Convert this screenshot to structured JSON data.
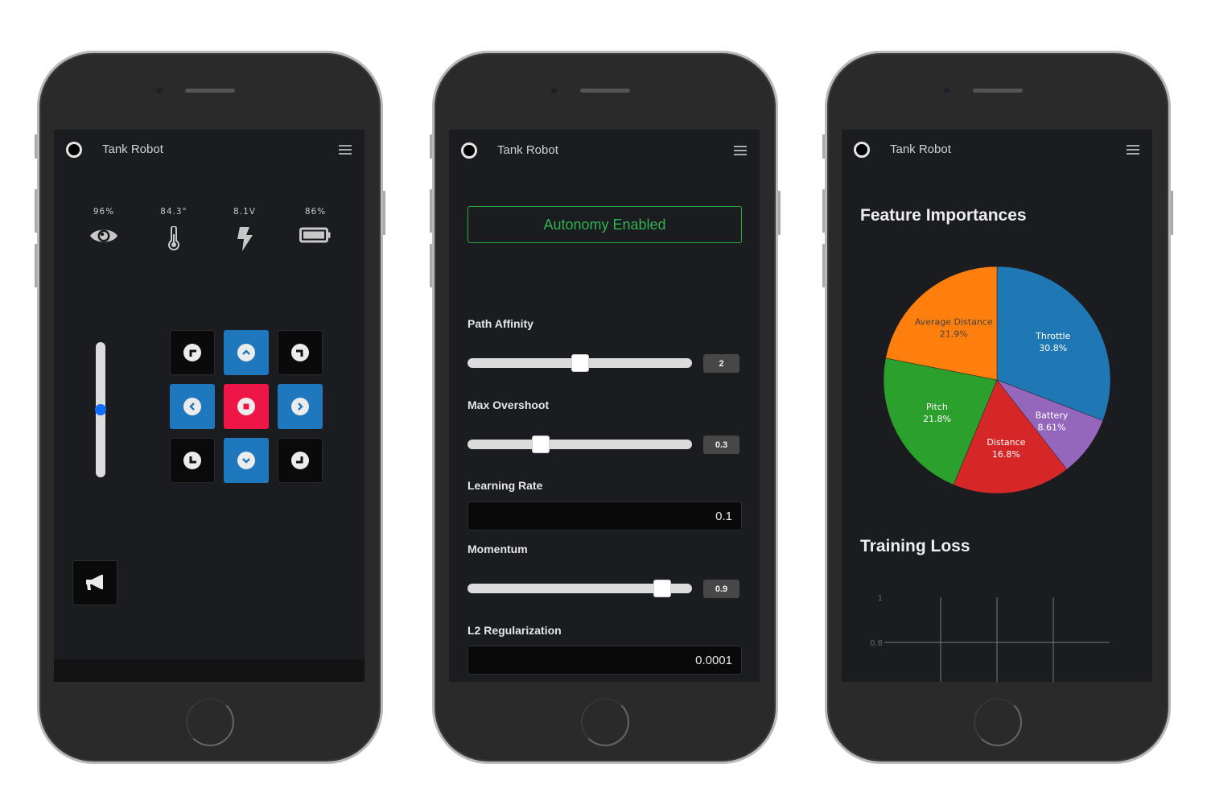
{
  "app": {
    "title": "Tank Robot"
  },
  "screen1": {
    "stats": [
      {
        "icon": "eye-icon",
        "value": "96%"
      },
      {
        "icon": "thermometer-icon",
        "value": "84.3°"
      },
      {
        "icon": "lightning-icon",
        "value": "8.1V"
      },
      {
        "icon": "battery-icon",
        "value": "86%"
      }
    ],
    "throttle": {
      "value_fraction": 0.5
    },
    "dpad": [
      {
        "name": "forward-left",
        "icon": "corner-up-left-icon",
        "style": "dark"
      },
      {
        "name": "forward",
        "icon": "chevron-up-icon",
        "style": "blue"
      },
      {
        "name": "forward-right",
        "icon": "corner-up-right-icon",
        "style": "dark"
      },
      {
        "name": "left",
        "icon": "chevron-left-icon",
        "style": "blue"
      },
      {
        "name": "stop",
        "icon": "stop-icon",
        "style": "red"
      },
      {
        "name": "right",
        "icon": "chevron-right-icon",
        "style": "blue"
      },
      {
        "name": "backward-left",
        "icon": "corner-down-left-icon",
        "style": "dark"
      },
      {
        "name": "backward",
        "icon": "chevron-down-icon",
        "style": "blue"
      },
      {
        "name": "backward-right",
        "icon": "corner-down-right-icon",
        "style": "dark"
      }
    ],
    "horn": {
      "icon": "megaphone-icon"
    }
  },
  "screen2": {
    "autonomy_label": "Autonomy Enabled",
    "path_affinity": {
      "label": "Path Affinity",
      "value": "2",
      "fraction": 0.5
    },
    "max_overshoot": {
      "label": "Max Overshoot",
      "value": "0.3",
      "fraction": 0.31
    },
    "learning_rate": {
      "label": "Learning Rate",
      "value": "0.1"
    },
    "momentum": {
      "label": "Momentum",
      "value": "0.9",
      "fraction": 0.9
    },
    "l2_regularization": {
      "label": "L2 Regularization",
      "value": "0.0001"
    }
  },
  "screen3": {
    "feature_title": "Feature Importances",
    "loss_title": "Training Loss"
  },
  "colors": {
    "accent_blue": "#1f78bd",
    "stop_red": "#ee1547",
    "autonomy_green": "#2fb150",
    "slider_blue": "#0d6efd"
  },
  "chart_data": [
    {
      "type": "pie",
      "title": "Feature Importances",
      "categories": [
        "Throttle",
        "Battery",
        "Distance",
        "Pitch",
        "Average Distance"
      ],
      "values": [
        30.8,
        8.61,
        16.8,
        21.8,
        21.9
      ],
      "labels": [
        "30.8%",
        "8.61%",
        "16.8%",
        "21.8%",
        "21.9%"
      ],
      "colors": [
        "#1f77b4",
        "#9467bd",
        "#d62728",
        "#2ca02c",
        "#ff7f0e"
      ],
      "label_colors": [
        "#ffffff",
        "#ffffff",
        "#ffffff",
        "#ffffff",
        "#444444"
      ],
      "start": "12 o'clock",
      "direction": "clockwise"
    },
    {
      "type": "line",
      "title": "Training Loss",
      "series": [],
      "ytick_labels": [
        "1",
        "0.8"
      ],
      "yticks": [
        1,
        0.8
      ],
      "x_gridlines": 3,
      "grid": true
    }
  ]
}
